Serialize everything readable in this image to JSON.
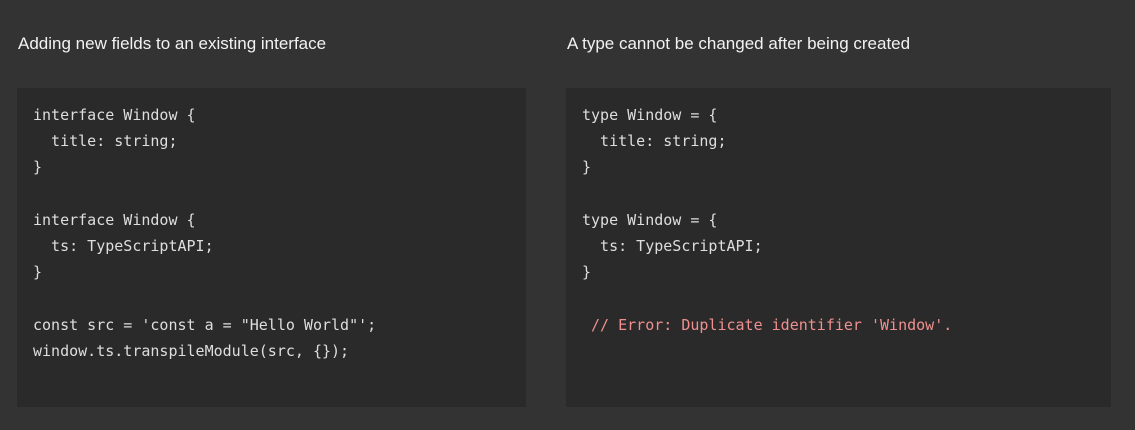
{
  "left": {
    "heading": "Adding new fields to an existing interface",
    "code_lines": [
      "interface Window {",
      "  title: string;",
      "}",
      "",
      "interface Window {",
      "  ts: TypeScriptAPI;",
      "}",
      "",
      "const src = 'const a = \"Hello World\"';",
      "window.ts.transpileModule(src, {});"
    ]
  },
  "right": {
    "heading": "A type cannot be changed after being created",
    "code_lines": [
      "type Window = {",
      "  title: string;",
      "}",
      "",
      "type Window = {",
      "  ts: TypeScriptAPI;",
      "}",
      "",
      " // Error: Duplicate identifier 'Window'."
    ]
  },
  "colors": {
    "background": "#333333",
    "code_background": "#2a2a2a",
    "code_text": "#dedede",
    "error_text": "#f08f8f",
    "heading_text": "#f2f2f2"
  }
}
